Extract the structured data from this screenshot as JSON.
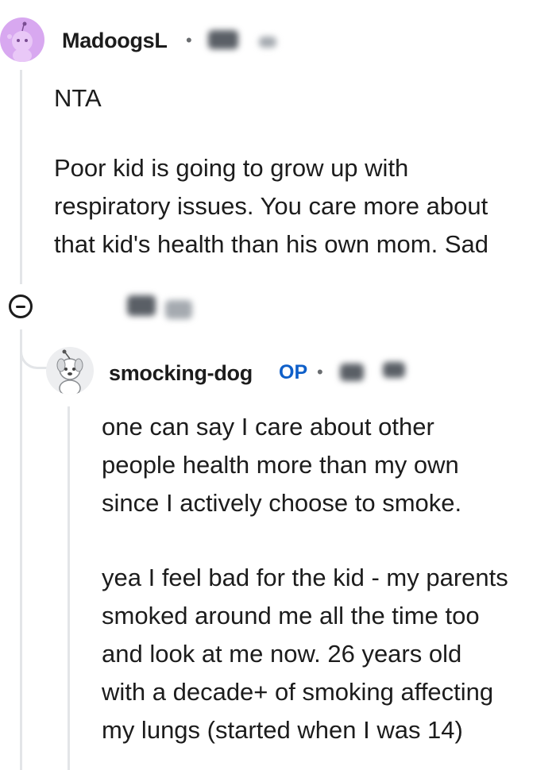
{
  "comments": [
    {
      "username": "MadoogsL",
      "separator": "•",
      "paragraphs": [
        "NTA",
        "Poor kid is going to grow up with\nrespiratory issues. You care more about\nthat kid's health than his own mom. Sad"
      ]
    },
    {
      "username": "smocking-dog",
      "badge": "OP",
      "separator": "•",
      "paragraphs": [
        "one can say I care about other\npeople health more than my own\nsince I actively choose to smoke.",
        "yea I feel bad for the kid - my parents\nsmoked around me all the time too\nand look at me now. 26 years old\nwith a decade+ of smoking affecting\nmy lungs (started when I was 14)"
      ]
    }
  ],
  "icons": {
    "avatar_1": "snoo-avatar-purple",
    "avatar_2": "snoo-avatar-dog",
    "collapse": "collapse-thread-icon"
  },
  "colors": {
    "op_badge": "#0e5fc9",
    "avatar_1_bg": "#d8a8f0",
    "thread_line": "#e3e5e8"
  }
}
